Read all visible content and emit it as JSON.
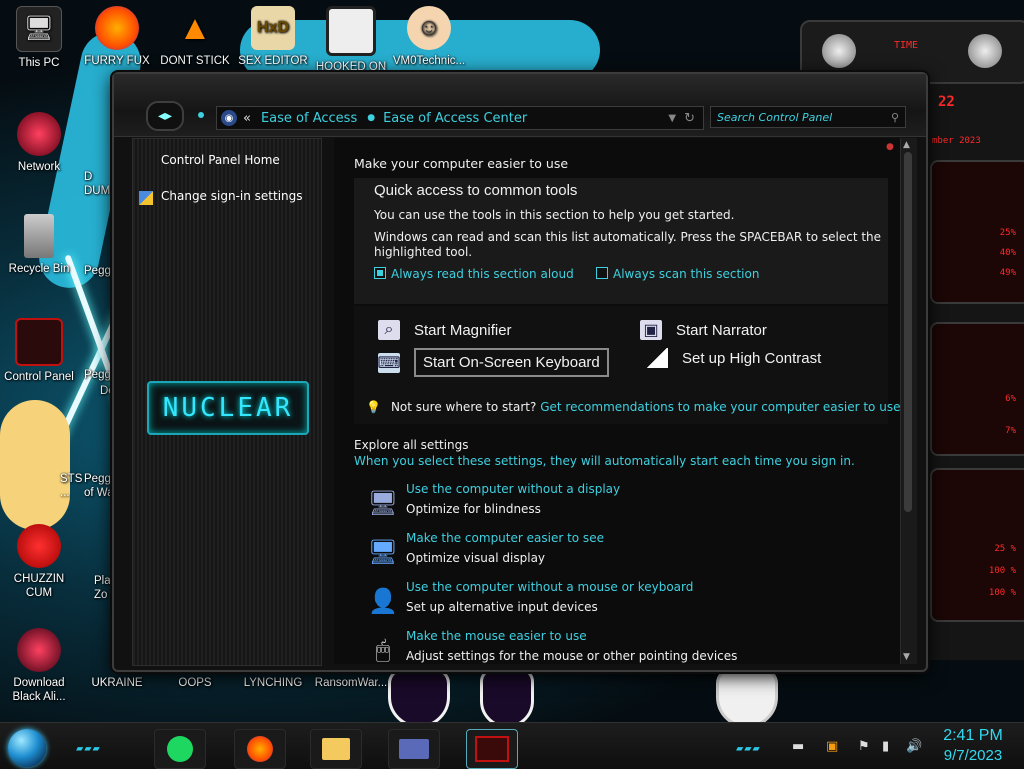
{
  "desktop": {
    "icons": [
      {
        "label": "This PC",
        "icon": "computer-icon"
      },
      {
        "label": "FURRY FUX",
        "icon": "firefox-icon"
      },
      {
        "label": "DONT STICK",
        "icon": "vlc-cone-icon"
      },
      {
        "label": "SEX EDITOR",
        "icon": "hxd-editor-icon"
      },
      {
        "label": "HOOKED ON",
        "icon": "maze-icon"
      },
      {
        "label": "VM0Technic...",
        "icon": "doctor-icon"
      },
      {
        "label": "Network",
        "icon": "network-icon"
      },
      {
        "label": "Recycle Bin",
        "icon": "recycle-bin-icon"
      },
      {
        "label": "Control Panel",
        "icon": "control-panel-icon"
      },
      {
        "label": "CHUZZIN CUM",
        "icon": "chuzzle-icon"
      },
      {
        "label": "Download Black Ali...",
        "icon": "alienware-icon"
      },
      {
        "label": "UKRAINE",
        "icon": "shortcut-icon"
      },
      {
        "label": "OOPS",
        "icon": "shortcut-icon"
      },
      {
        "label": "LYNCHING",
        "icon": "shortcut-icon"
      },
      {
        "label": "RansomWar...",
        "icon": "shortcut-icon"
      }
    ],
    "partial_labels": [
      "D",
      "DUM",
      "Peggle",
      "Peggle",
      "De",
      "STS",
      "...",
      "Peggle",
      "of Wa",
      "Plan",
      "Zo"
    ]
  },
  "gadget": {
    "time_label": "TIME",
    "number": "22",
    "date_partial": "mber 2023",
    "values": [
      "25%",
      "40%",
      "49%",
      "6%",
      "7%",
      "25 %",
      "100 %",
      "100 %"
    ],
    "accent_color": "#ff2a2a"
  },
  "window": {
    "breadcrumb_prefix": "«",
    "breadcrumb": [
      "Ease of Access",
      "Ease of Access Center"
    ],
    "search_placeholder": "Search Control Panel",
    "sidebar": {
      "links": [
        "Control Panel Home",
        "Change sign-in settings"
      ],
      "logo_text": "NUCLEAR"
    },
    "main": {
      "heading": "Make your computer easier to use",
      "quick_access": {
        "title": "Quick access to common tools",
        "line1": "You can use the tools in this section to help you get started.",
        "line2": "Windows can read and scan this list automatically.  Press the SPACEBAR to select the",
        "line3": "highlighted tool.",
        "check_read_aloud": {
          "label": "Always read this section aloud",
          "checked": true
        },
        "check_scan": {
          "label": "Always scan this section",
          "checked": false
        }
      },
      "tools": {
        "magnifier": "Start Magnifier",
        "narrator": "Start Narrator",
        "keyboard": "Start On-Screen Keyboard",
        "contrast": "Set up High Contrast"
      },
      "recommendation": {
        "prefix": "Not sure where to start?",
        "link": "Get recommendations to make your computer easier to use"
      },
      "explore": {
        "heading": "Explore all settings",
        "subheading": "When you select these settings, they will automatically start each time you sign in.",
        "items": [
          {
            "link": "Use the computer without a display",
            "desc": "Optimize for blindness"
          },
          {
            "link": "Make the computer easier to see",
            "desc": "Optimize visual display"
          },
          {
            "link": "Use the computer without a mouse or keyboard",
            "desc": "Set up alternative input devices"
          },
          {
            "link": "Make the mouse easier to use",
            "desc": "Adjust settings for the mouse or other pointing devices"
          }
        ]
      }
    }
  },
  "taskbar": {
    "pinned": [
      "spotify-icon",
      "firefox-icon",
      "file-explorer-icon",
      "control-panel-icon",
      "alienware-app-icon"
    ],
    "clock_time": "2:41 PM",
    "clock_date": "9/7/2023",
    "accent_color": "#32d9f0"
  }
}
